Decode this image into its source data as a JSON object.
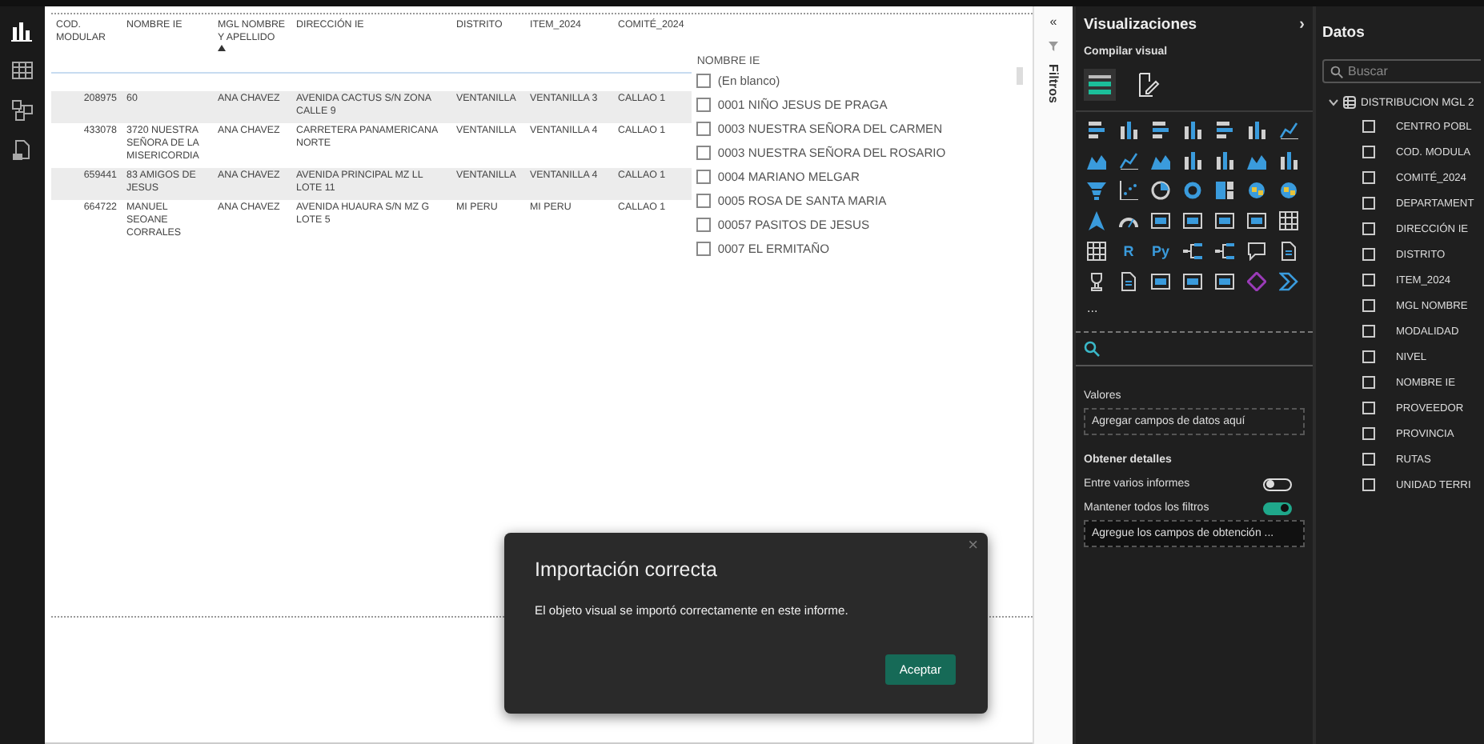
{
  "rail": [
    {
      "kind": "report",
      "selected": true
    },
    {
      "kind": "table",
      "selected": false
    },
    {
      "kind": "model",
      "selected": false
    },
    {
      "kind": "dax",
      "selected": false
    }
  ],
  "table": {
    "columns": [
      {
        "label": "COD. MODULAR",
        "sorted": false
      },
      {
        "label": "NOMBRE IE",
        "sorted": false
      },
      {
        "label": "MGL NOMBRE Y APELLIDO",
        "sorted": true
      },
      {
        "label": "DIRECCIÓN IE",
        "sorted": false
      },
      {
        "label": "DISTRITO",
        "sorted": false
      },
      {
        "label": "ITEM_2024",
        "sorted": false
      },
      {
        "label": "COMITÉ_2024",
        "sorted": false
      }
    ],
    "rows": [
      [
        "208975",
        "60",
        "ANA CHAVEZ",
        "AVENIDA CACTUS S/N ZONA CALLE 9",
        "VENTANILLA",
        "VENTANILLA 3",
        "CALLAO 1"
      ],
      [
        "433078",
        "3720 NUESTRA SEÑORA DE LA MISERICORDIA",
        "ANA CHAVEZ",
        "CARRETERA PANAMERICANA NORTE",
        "VENTANILLA",
        "VENTANILLA 4",
        "CALLAO 1"
      ],
      [
        "659441",
        "83 AMIGOS DE JESUS",
        "ANA CHAVEZ",
        "AVENIDA PRINCIPAL MZ LL LOTE 11",
        "VENTANILLA",
        "VENTANILLA 4",
        "CALLAO 1"
      ],
      [
        "664722",
        "MANUEL SEOANE CORRALES",
        "ANA CHAVEZ",
        "AVENIDA HUAURA S/N MZ G LOTE 5",
        "MI PERU",
        "MI PERU",
        "CALLAO 1"
      ]
    ]
  },
  "slicer": {
    "title": "NOMBRE IE",
    "items": [
      {
        "label": "(En blanco)",
        "checked": false
      },
      {
        "label": "0001 NIÑO JESUS DE PRAGA",
        "checked": false
      },
      {
        "label": "0003 NUESTRA SEÑORA DEL CARMEN",
        "checked": false
      },
      {
        "label": "0003 NUESTRA SEÑORA DEL ROSARIO",
        "checked": false
      },
      {
        "label": "0004 MARIANO MELGAR",
        "checked": false
      },
      {
        "label": "0005 ROSA DE SANTA MARIA",
        "checked": false
      },
      {
        "label": "00057 PASITOS DE JESUS",
        "checked": false
      },
      {
        "label": "0007 EL ERMITAÑO",
        "checked": false
      }
    ]
  },
  "filters_pane": {
    "collapse": "«",
    "title": "Filtros"
  },
  "visualizations": {
    "title": "Visualizaciones",
    "expand": "›",
    "subtitle": "Compilar visual",
    "modes": [
      {
        "kind": "build",
        "selected": true
      },
      {
        "kind": "format",
        "selected": false
      }
    ],
    "gallery": [
      {
        "kind": "hbar"
      },
      {
        "kind": "vbar"
      },
      {
        "kind": "hbar"
      },
      {
        "kind": "vbar"
      },
      {
        "kind": "hbar"
      },
      {
        "kind": "vbar"
      },
      {
        "kind": "line"
      },
      {
        "kind": "area"
      },
      {
        "kind": "line"
      },
      {
        "kind": "area"
      },
      {
        "kind": "vbar"
      },
      {
        "kind": "vbar"
      },
      {
        "kind": "area"
      },
      {
        "kind": "vbar"
      },
      {
        "kind": "funnel"
      },
      {
        "kind": "scatter"
      },
      {
        "kind": "pie"
      },
      {
        "kind": "donut"
      },
      {
        "kind": "treemap"
      },
      {
        "kind": "globe"
      },
      {
        "kind": "globe"
      },
      {
        "kind": "arrow"
      },
      {
        "kind": "gauge"
      },
      {
        "kind": "card"
      },
      {
        "kind": "card"
      },
      {
        "kind": "card"
      },
      {
        "kind": "card"
      },
      {
        "kind": "table"
      },
      {
        "kind": "table"
      },
      {
        "kind": "text",
        "text": "R"
      },
      {
        "kind": "text",
        "text": "Py"
      },
      {
        "kind": "tree"
      },
      {
        "kind": "tree"
      },
      {
        "kind": "bubble"
      },
      {
        "kind": "doc"
      },
      {
        "kind": "trophy"
      },
      {
        "kind": "doc"
      },
      {
        "kind": "card"
      },
      {
        "kind": "card"
      },
      {
        "kind": "card"
      },
      {
        "kind": "diamond"
      },
      {
        "kind": "chevron"
      }
    ],
    "more": "...",
    "values_label": "Valores",
    "values_placeholder": "Agregar campos de datos aquí",
    "drill_title": "Obtener detalles",
    "toggles": [
      {
        "label": "Entre varios informes",
        "on": false
      },
      {
        "label": "Mantener todos los filtros",
        "on": true
      }
    ],
    "drill_placeholder": "Agregue los campos de obtención ..."
  },
  "data_pane": {
    "title": "Datos",
    "search_placeholder": "Buscar",
    "tree": [
      {
        "label": "DISTRIBUCION MGL 2",
        "expanded": true,
        "children": [
          {
            "label": "CENTRO POBL",
            "checked": false
          },
          {
            "label": "COD. MODULA",
            "checked": false
          },
          {
            "label": "COMITÉ_2024",
            "checked": false
          },
          {
            "label": "DEPARTAMENT",
            "checked": false
          },
          {
            "label": "DIRECCIÓN IE",
            "checked": false
          },
          {
            "label": "DISTRITO",
            "checked": false
          },
          {
            "label": "ITEM_2024",
            "checked": false
          },
          {
            "label": "MGL NOMBRE",
            "checked": false
          },
          {
            "label": "MODALIDAD",
            "checked": false
          },
          {
            "label": "NIVEL",
            "checked": false
          },
          {
            "label": "NOMBRE IE",
            "checked": false
          },
          {
            "label": "PROVEEDOR",
            "checked": false
          },
          {
            "label": "PROVINCIA",
            "checked": false
          },
          {
            "label": "RUTAS",
            "checked": false
          },
          {
            "label": "UNIDAD TERRI",
            "checked": false
          }
        ]
      }
    ]
  },
  "dialog": {
    "title": "Importación correcta",
    "message": "El objeto visual se importó correctamente en este informe.",
    "button": "Aceptar",
    "close": "×"
  }
}
